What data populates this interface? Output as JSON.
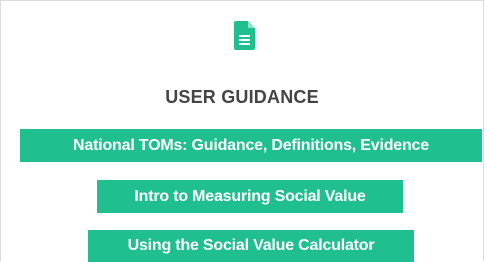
{
  "panel": {
    "icon": "document-icon",
    "accent_color": "#1fbf8f",
    "title": "USER GUIDANCE",
    "links": [
      {
        "label": "National TOMs: Guidance, Definitions, Evidence"
      },
      {
        "label": "Intro to Measuring Social Value"
      },
      {
        "label": "Using the Social Value Calculator"
      }
    ]
  }
}
